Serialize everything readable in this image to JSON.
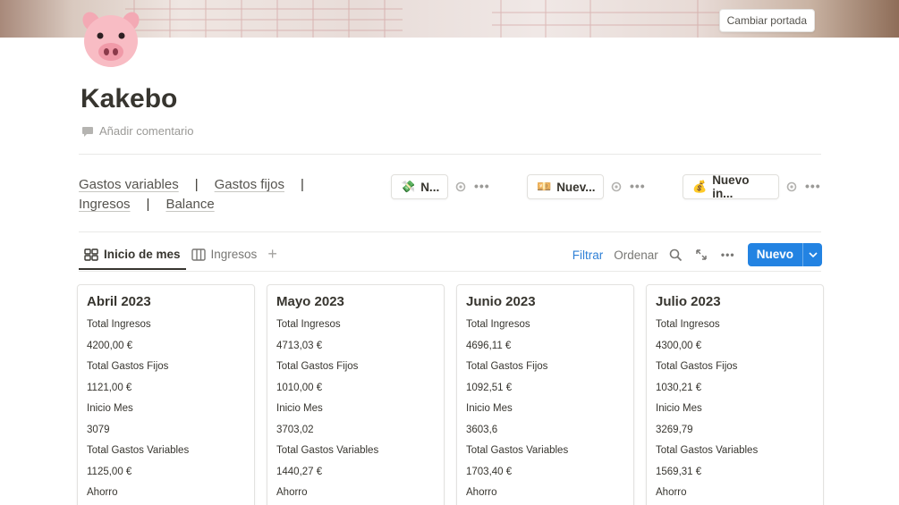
{
  "cover": {
    "button_label": "Cambiar portada"
  },
  "page": {
    "icon": "pig-face-icon",
    "title": "Kakebo",
    "add_comment": "Añadir comentario"
  },
  "links": {
    "items": [
      "Gastos variables",
      "Gastos fijos",
      "Ingresos",
      "Balance"
    ],
    "separator": "|"
  },
  "templates": [
    {
      "emoji": "💸",
      "label": "N..."
    },
    {
      "emoji": "💴",
      "label": "Nuev..."
    },
    {
      "emoji": "💰",
      "label": "Nuevo in..."
    }
  ],
  "tabs": [
    {
      "label": "Inicio de mes",
      "icon": "board-icon",
      "active": true
    },
    {
      "label": "Ingresos",
      "icon": "table-icon",
      "active": false
    }
  ],
  "toolbar": {
    "filter": "Filtrar",
    "order": "Ordenar",
    "new": "Nuevo"
  },
  "cards": [
    {
      "title": "Abril 2023",
      "props": [
        "Total Ingresos",
        "4200,00 €",
        "Total Gastos Fijos",
        "1121,00 €",
        "Inicio Mes",
        "3079",
        "Total Gastos Variables",
        "1125,00 €",
        "Ahorro"
      ]
    },
    {
      "title": "Mayo 2023",
      "props": [
        "Total Ingresos",
        "4713,03 €",
        "Total Gastos Fijos",
        "1010,00 €",
        "Inicio Mes",
        "3703,02",
        "Total Gastos Variables",
        "1440,27 €",
        "Ahorro"
      ]
    },
    {
      "title": "Junio 2023",
      "props": [
        "Total Ingresos",
        "4696,11 €",
        "Total Gastos Fijos",
        "1092,51 €",
        "Inicio Mes",
        "3603,6",
        "Total Gastos Variables",
        "1703,40 €",
        "Ahorro"
      ]
    },
    {
      "title": "Julio 2023",
      "props": [
        "Total Ingresos",
        "4300,00 €",
        "Total Gastos Fijos",
        "1030,21 €",
        "Inicio Mes",
        "3269,79",
        "Total Gastos Variables",
        "1569,31 €",
        "Ahorro"
      ]
    }
  ],
  "colors": {
    "accent": "#2383e2",
    "filter": "#2f80d6",
    "text": "#37352f"
  }
}
